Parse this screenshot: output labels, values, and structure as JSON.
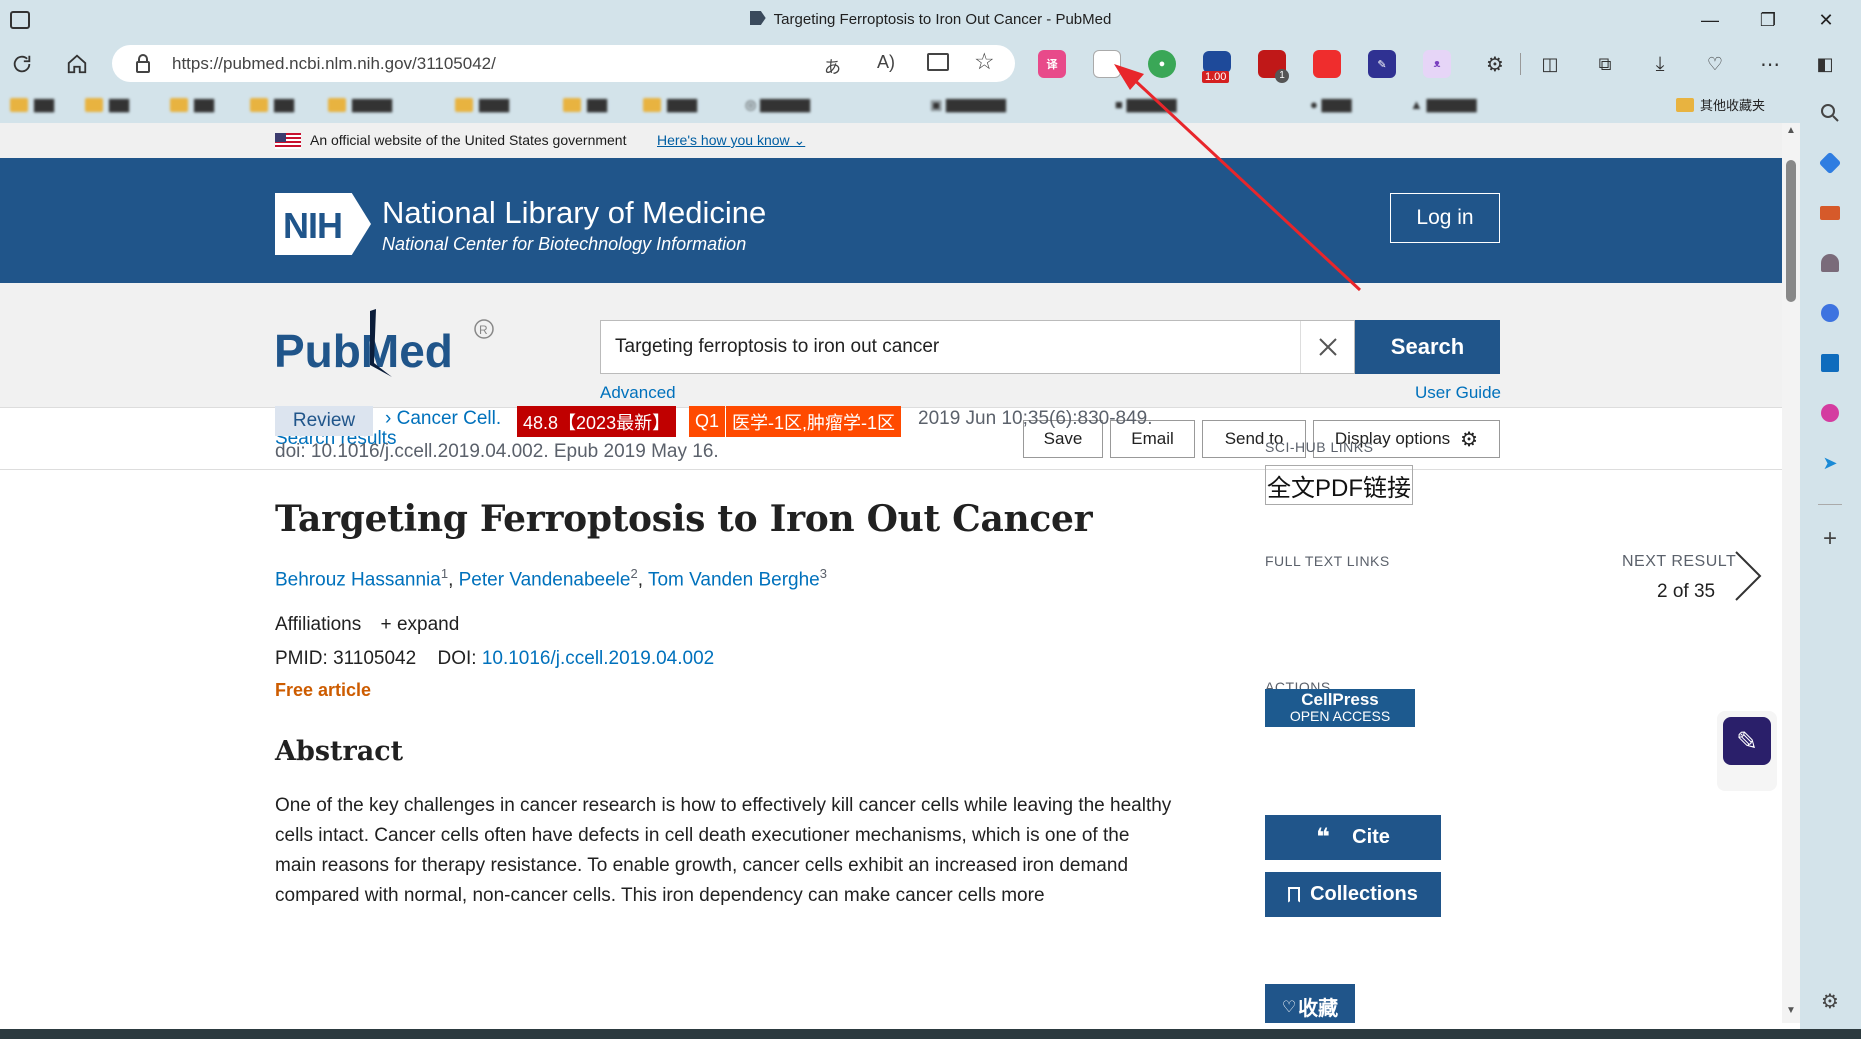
{
  "window": {
    "title": "Targeting Ferroptosis to Iron Out Cancer - PubMed"
  },
  "address": {
    "url": "https://pubmed.ncbi.nlm.nih.gov/31105042/"
  },
  "extensions": {
    "badge_value": "1.00",
    "badge_count": "1"
  },
  "bookmarks": {
    "other_folder": "其他收藏夹"
  },
  "gov_banner": {
    "text": "An official website of the United States government",
    "link": "Here's how you know"
  },
  "nlm": {
    "logo": "NIH",
    "title": "National Library of Medicine",
    "subtitle": "National Center for Biotechnology Information",
    "login": "Log in"
  },
  "search": {
    "logo": "PubMed",
    "value": "Targeting ferroptosis to iron out cancer",
    "button": "Search",
    "advanced": "Advanced",
    "user_guide": "User Guide"
  },
  "actions_bar": {
    "search_results": "Search results",
    "save": "Save",
    "email": "Email",
    "send_to": "Send to",
    "display_options": "Display options"
  },
  "article": {
    "type": "Review",
    "journal": "Cancer Cell.",
    "impact_tag": "48.8【2023最新】",
    "quartile_tag": "Q1",
    "division_tag": "医学-1区,肿瘤学-1区",
    "citation": "2019 Jun 10;35(6):830-849.",
    "doi_line": "doi: 10.1016/j.ccell.2019.04.002. Epub 2019 May 16.",
    "title": "Targeting Ferroptosis to Iron Out Cancer",
    "authors": [
      {
        "name": "Behrouz Hassannia",
        "sup": "1"
      },
      {
        "name": "Peter Vandenabeele",
        "sup": "2"
      },
      {
        "name": "Tom Vanden Berghe",
        "sup": "3"
      }
    ],
    "affiliations_label": "Affiliations",
    "expand_label": "expand",
    "pmid_label": "PMID:",
    "pmid": "31105042",
    "doi_label": "DOI:",
    "doi": "10.1016/j.ccell.2019.04.002",
    "free": "Free article",
    "abstract_heading": "Abstract",
    "abstract": "One of the key challenges in cancer research is how to effectively kill cancer cells while leaving the healthy cells intact. Cancer cells often have defects in cell death executioner mechanisms, which is one of the main reasons for therapy resistance. To enable growth, cancer cells exhibit an increased iron demand compared with normal, non-cancer cells. This iron dependency can make cancer cells more"
  },
  "sidebar": {
    "scihub_heading": "SCI-HUB LINKS",
    "scihub_button": "全文PDF链接",
    "fulltext_heading": "FULL TEXT LINKS",
    "cellpress_top": "CellPress",
    "cellpress_bottom": "OPEN ACCESS",
    "actions_heading": "ACTIONS",
    "cite": "Cite",
    "collections": "Collections",
    "favorite": "收藏",
    "next_result_label": "NEXT RESULT",
    "next_result_count": "2 of 35"
  },
  "colors": {
    "nlm_blue": "#20558a",
    "link_blue": "#0071bc",
    "tag_dark_red": "#c00000",
    "tag_orange": "#ff4a00",
    "annotation_arrow": "#e8262b"
  }
}
